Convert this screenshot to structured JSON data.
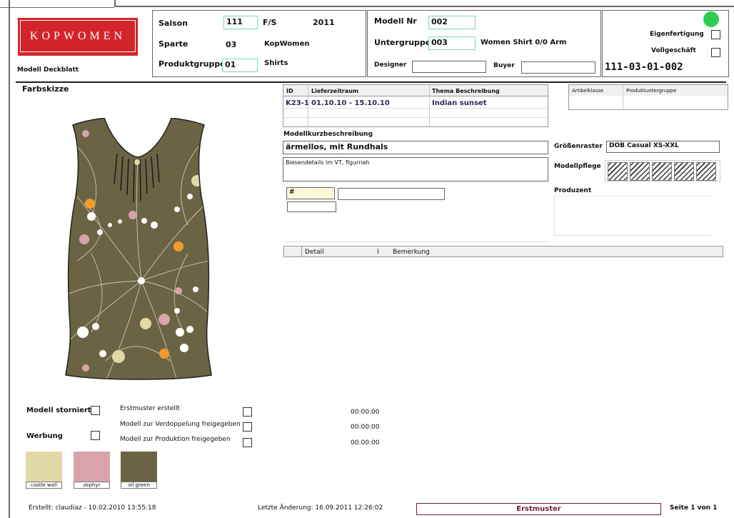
{
  "logo": {
    "text": "KOPWOMEN",
    "color": "#d3242c"
  },
  "header": {
    "document_type": "Modell Deckblatt",
    "saison_label": "Saison",
    "saison_value": "111",
    "fs_label": "F/S",
    "year": "2011",
    "sparte_label": "Sparte",
    "sparte_code": "03",
    "sparte_name": "KopWomen",
    "produktgruppe_label": "Produktgruppe",
    "produktgruppe_code": "01",
    "produktgruppe_name": "Shirts",
    "modell_nr_label": "Modell Nr",
    "modell_nr_value": "002",
    "untergruppe_label": "Untergruppe",
    "untergruppe_code": "003",
    "untergruppe_name": "Women Shirt 0/0 Arm",
    "designer_label": "Designer",
    "designer_value": "",
    "buyer_label": "Buyer",
    "buyer_value": "",
    "eigenfertigung_label": "Eigenfertigung",
    "vollgeschaeft_label": "Vollgeschäft",
    "model_code": "111-03-01-002",
    "status_color": "#2ecc52"
  },
  "sketch": {
    "label": "Farbskizze",
    "fabric_color": "#6b6444"
  },
  "delivery_table": {
    "headers": [
      "ID",
      "Lieferzeitraum",
      "Thema Beschreibung"
    ],
    "rows": [
      [
        "K23-1",
        "01.10.10 - 15.10.10",
        "Indian sunset"
      ]
    ]
  },
  "class_table": {
    "headers": [
      "Artikelklasse",
      "Produktuntergruppe"
    ]
  },
  "description": {
    "label": "Modellkurzbeschreibung",
    "short": "ärmellos, mit Rundhals",
    "long": "Biesendetails im VT, figurnah",
    "hash": "#"
  },
  "groessenraster": {
    "label": "Größenraster",
    "value": "DOB Casual XS-XXL"
  },
  "modellpflege": {
    "label": "Modellpflege"
  },
  "produzent": {
    "label": "Produzent"
  },
  "detail_table": {
    "headers": [
      "Detail",
      "I",
      "Bemerkung"
    ]
  },
  "flags": {
    "storniert": "Modell storniert",
    "werbung": "Werbung",
    "tasks": [
      {
        "label": "Erstmuster erstellt",
        "time": "00:00:00"
      },
      {
        "label": "Modell zur Verdoppelung freigegeben",
        "time": "00:00:00"
      },
      {
        "label": "Modell zur Produktion freigegeben",
        "time": "00:00:00"
      }
    ]
  },
  "swatches": [
    {
      "name": "castle wall",
      "color": "#e2d9a6"
    },
    {
      "name": "zephyr",
      "color": "#d8a3ab"
    },
    {
      "name": "oil green",
      "color": "#6b6444"
    }
  ],
  "footer": {
    "erstellt": "Erstellt:  claudiaz - 10.02.2010 13:55:18",
    "letzte": "Letzte Änderung:   16.09.2011 12:26:02",
    "status": "Erstmuster",
    "status_color": "#6b1f3c",
    "page": "Seite 1 von 1"
  }
}
